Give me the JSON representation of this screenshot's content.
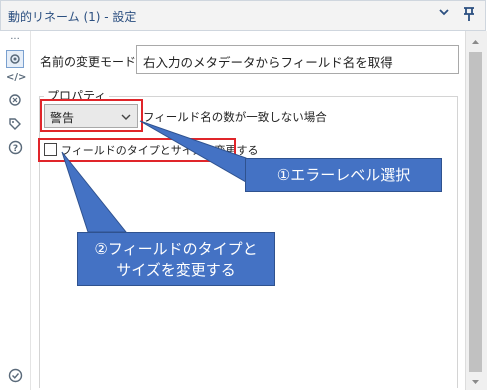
{
  "window": {
    "title": "動的リネーム (1) - 設定",
    "collapse_icon": "chevron-down-icon",
    "pin_icon": "pin-icon"
  },
  "sidebar": {
    "items": [
      {
        "name": "more-icon",
        "glyph": "···"
      },
      {
        "name": "settings-icon",
        "glyph": "⚙"
      },
      {
        "name": "code-icon",
        "glyph": "</>"
      },
      {
        "name": "refresh-icon",
        "glyph": "⟳"
      },
      {
        "name": "tag-icon",
        "glyph": "◇"
      },
      {
        "name": "help-icon",
        "glyph": "?"
      },
      {
        "name": "check-circle-icon",
        "glyph": "✓"
      }
    ]
  },
  "form": {
    "mode_label": "名前の変更モード:",
    "mode_value": "右入力のメタデータからフィールド名を取得",
    "properties_legend": "プロパティ",
    "level_value": "警告",
    "level_label": "フィールド名の数が一致しない場合",
    "change_type_label": "フィールドのタイプとサイズを変更する",
    "change_type_checked": false
  },
  "annotations": {
    "callout_1": "①エラーレベル選択",
    "callout_2_line1": "②フィールドのタイプと",
    "callout_2_line2": "サイズを変更する"
  },
  "colors": {
    "highlight": "#e0252a",
    "callout_fill": "#4472c4",
    "title_text": "#2b4f80"
  }
}
